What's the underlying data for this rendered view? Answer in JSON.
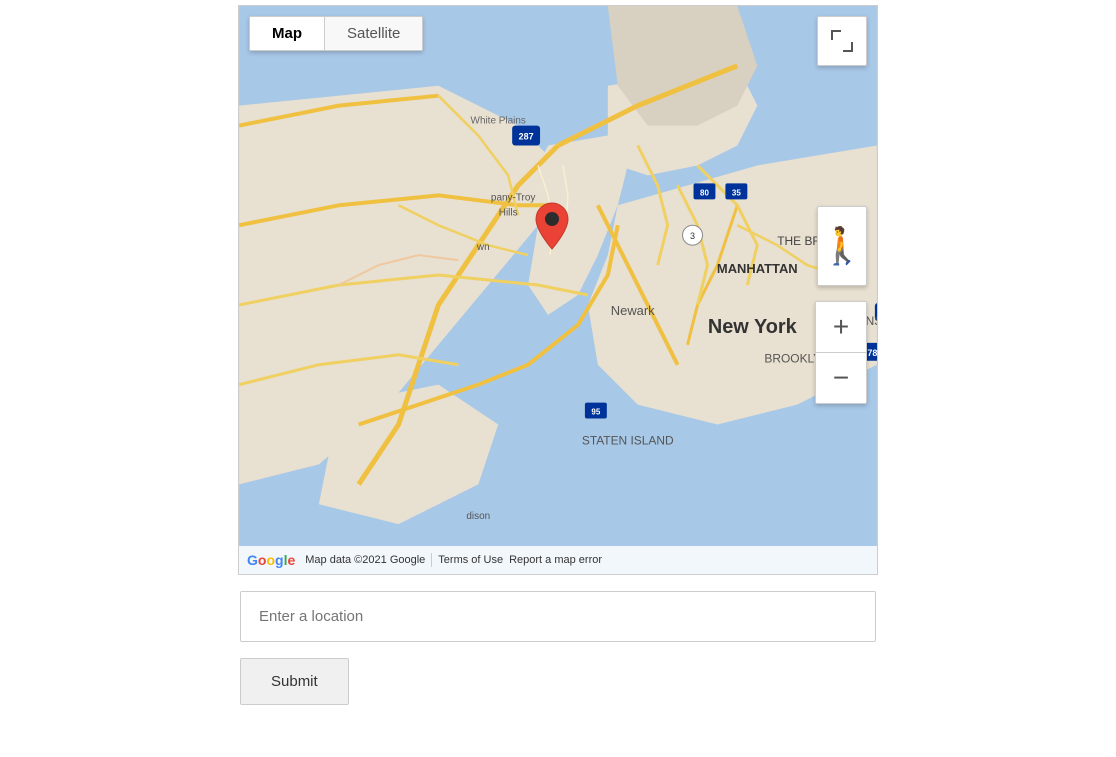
{
  "map": {
    "type_toggle": {
      "map_label": "Map",
      "satellite_label": "Satellite",
      "active": "map"
    },
    "footer": {
      "attribution": "Map data ©2021 Google",
      "terms_of_use": "Terms of Use",
      "report_error": "Report a map error"
    },
    "zoom": {
      "plus": "+",
      "minus": "−"
    }
  },
  "location_input": {
    "placeholder": "Enter a location",
    "value": ""
  },
  "submit_button": {
    "label": "Submit"
  }
}
